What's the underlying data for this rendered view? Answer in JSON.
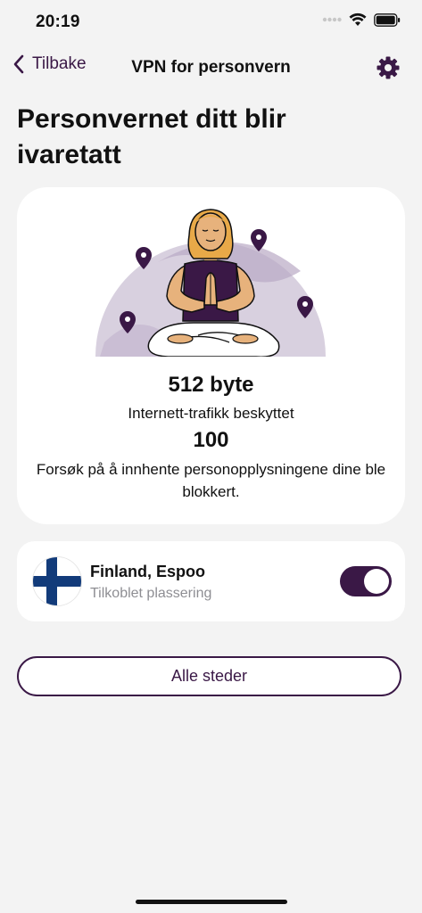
{
  "status_bar": {
    "time": "20:19",
    "icons": [
      "signal-dots-icon",
      "wifi-icon",
      "battery-icon"
    ]
  },
  "nav": {
    "back_label": "Tilbake",
    "title": "VPN for personvern",
    "settings_icon": "gear-icon"
  },
  "page": {
    "title": "Personvernet ditt blir ivaretatt"
  },
  "stats": {
    "bytes_value": "512 byte",
    "bytes_label": "Internett-trafikk beskyttet",
    "blocked_value": "100",
    "blocked_label": "Forsøk på å innhente personopplysningene dine ble blokkert."
  },
  "location": {
    "name": "Finland, Espoo",
    "status": "Tilkoblet plassering",
    "flag_icon": "finland-flag-icon",
    "connected": true
  },
  "actions": {
    "all_locations_label": "Alle steder"
  },
  "colors": {
    "accent": "#3a1846",
    "background": "#f3f3f3",
    "card": "#ffffff",
    "flag_blue": "#123b7a",
    "illustration_bg": "#d8d0df"
  }
}
